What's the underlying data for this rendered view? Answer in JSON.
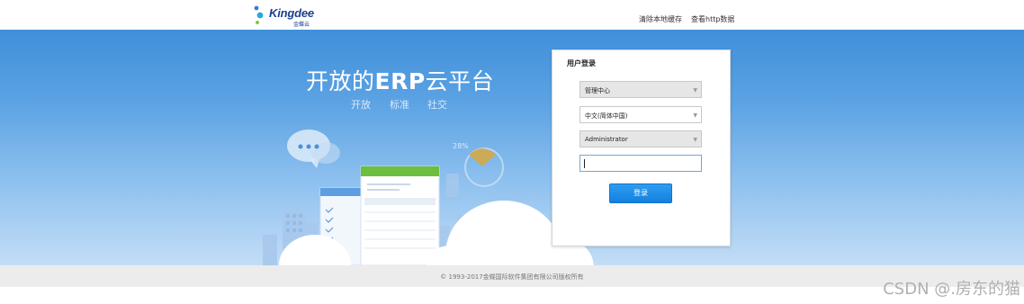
{
  "header": {
    "brand": "Kingdee",
    "brand_sub": "金蝶云",
    "links": [
      "清除本地缓存",
      "查看http数据"
    ]
  },
  "hero": {
    "title_prefix": "开放的",
    "title_bold": "ERP",
    "title_suffix": "云平台",
    "taglines": [
      "开放",
      "标准",
      "社交"
    ],
    "percent_label": "28%"
  },
  "login": {
    "title": "用户登录",
    "datacenter": "管理中心",
    "language": "中文(简体中国)",
    "username": "Administrator",
    "password": "",
    "submit_label": "登录"
  },
  "footer": {
    "copyright": "© 1993-2017金蝶国际软件集团有限公司版权所有"
  },
  "watermark": "CSDN @.房东的猫",
  "colors": {
    "brand": "#1a3f8f",
    "hero_top": "#3f8fd9",
    "hero_bottom": "#c3ddf6",
    "button": "#1a8ae8",
    "accent_green": "#6cbf3f",
    "accent_gold": "#d4aa48"
  }
}
